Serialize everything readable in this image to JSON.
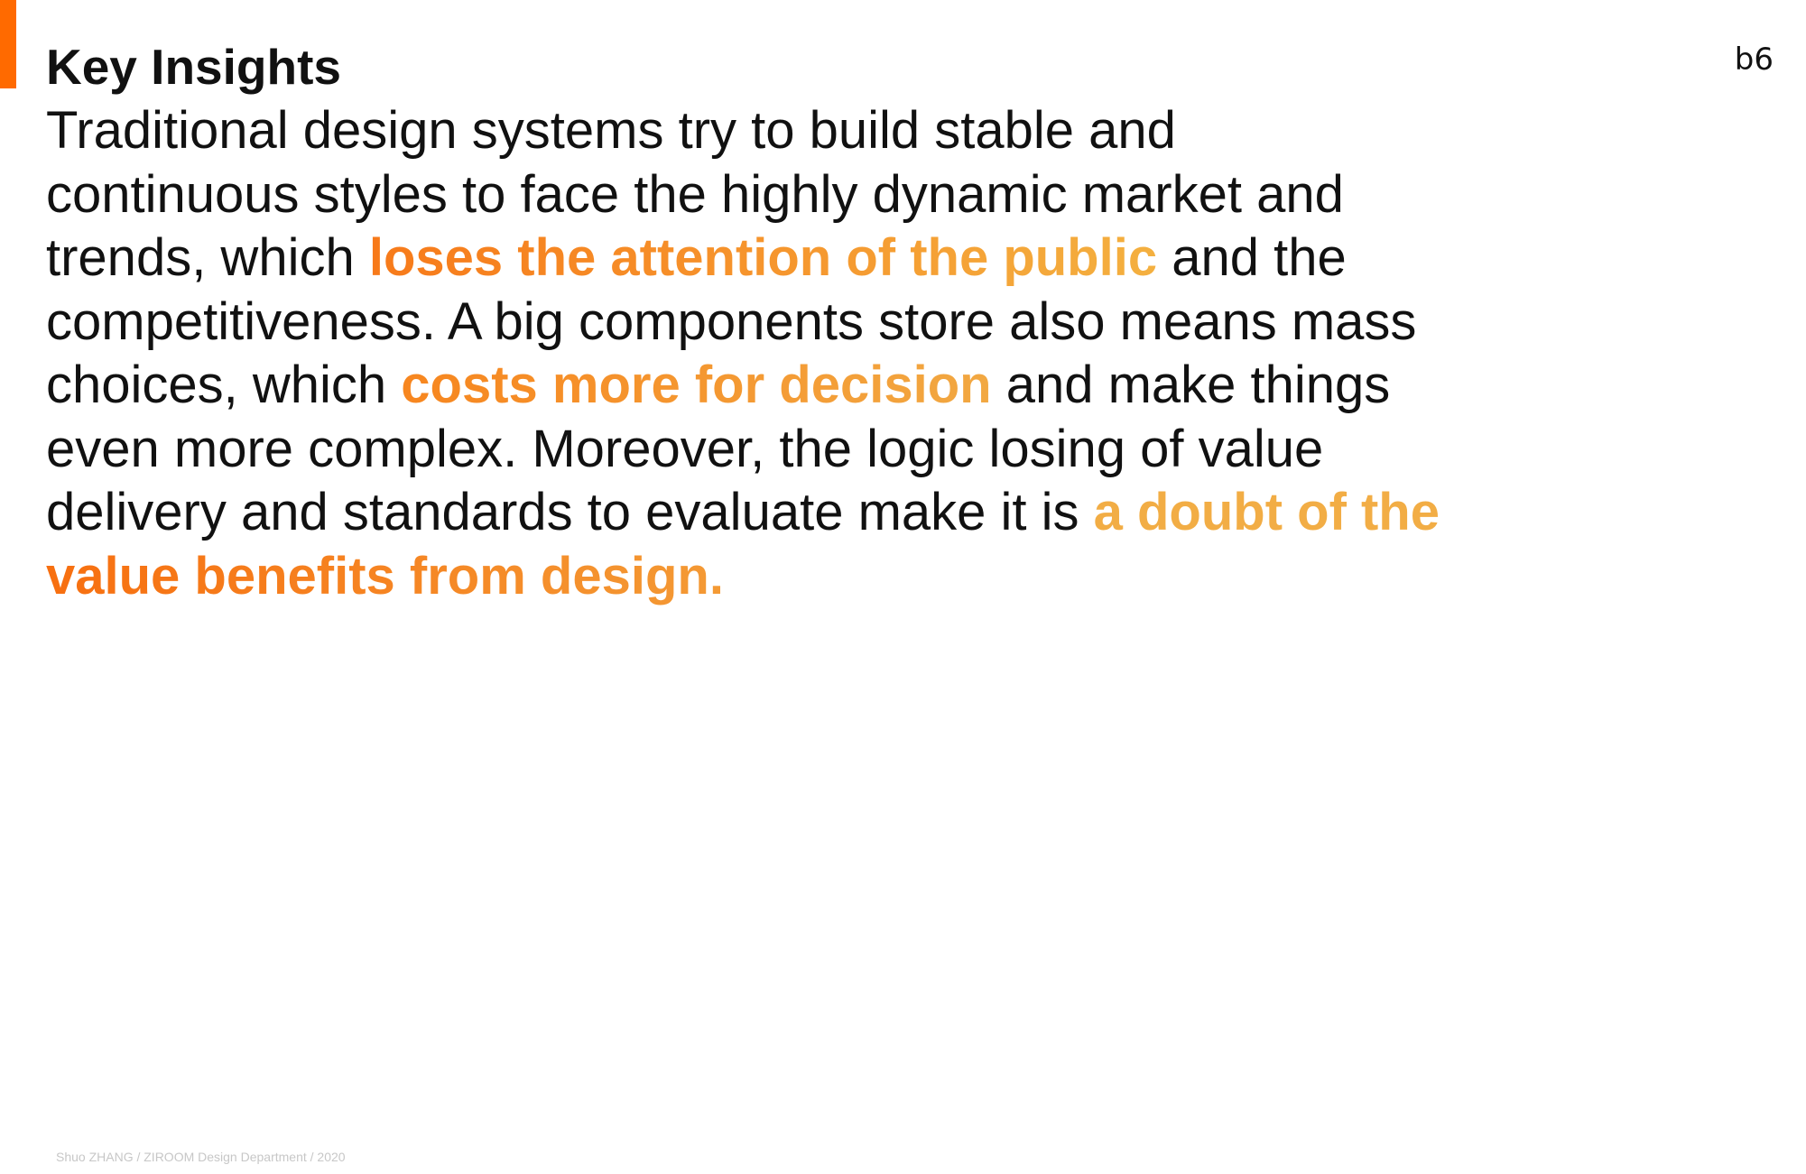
{
  "page_number": "b6",
  "title": "Key Insights",
  "colors": {
    "accent_bar": "#ff6a00",
    "highlight_light": "#f4a43d",
    "highlight_strong": "#f77a1a"
  },
  "body": {
    "line1": "Traditional design systems try to build stable and",
    "line2": "continuous styles to face the highly dynamic market and",
    "line3_pre": "trends, which ",
    "highlight1": "loses the attention of the public",
    "line3_post": " and the",
    "line4": "competitiveness. A big components store also means mass",
    "line5_pre": "choices, which ",
    "highlight2": "costs more for decision",
    "line5_post": " and make things",
    "line6": "even more complex. Moreover, the logic losing of value",
    "line7_pre": "delivery and standards to evaluate make it is ",
    "highlight3a": "a doubt of the",
    "highlight3b": "value benefits from design."
  },
  "footer": "Shuo ZHANG / ZIROOM Design Department / 2020"
}
